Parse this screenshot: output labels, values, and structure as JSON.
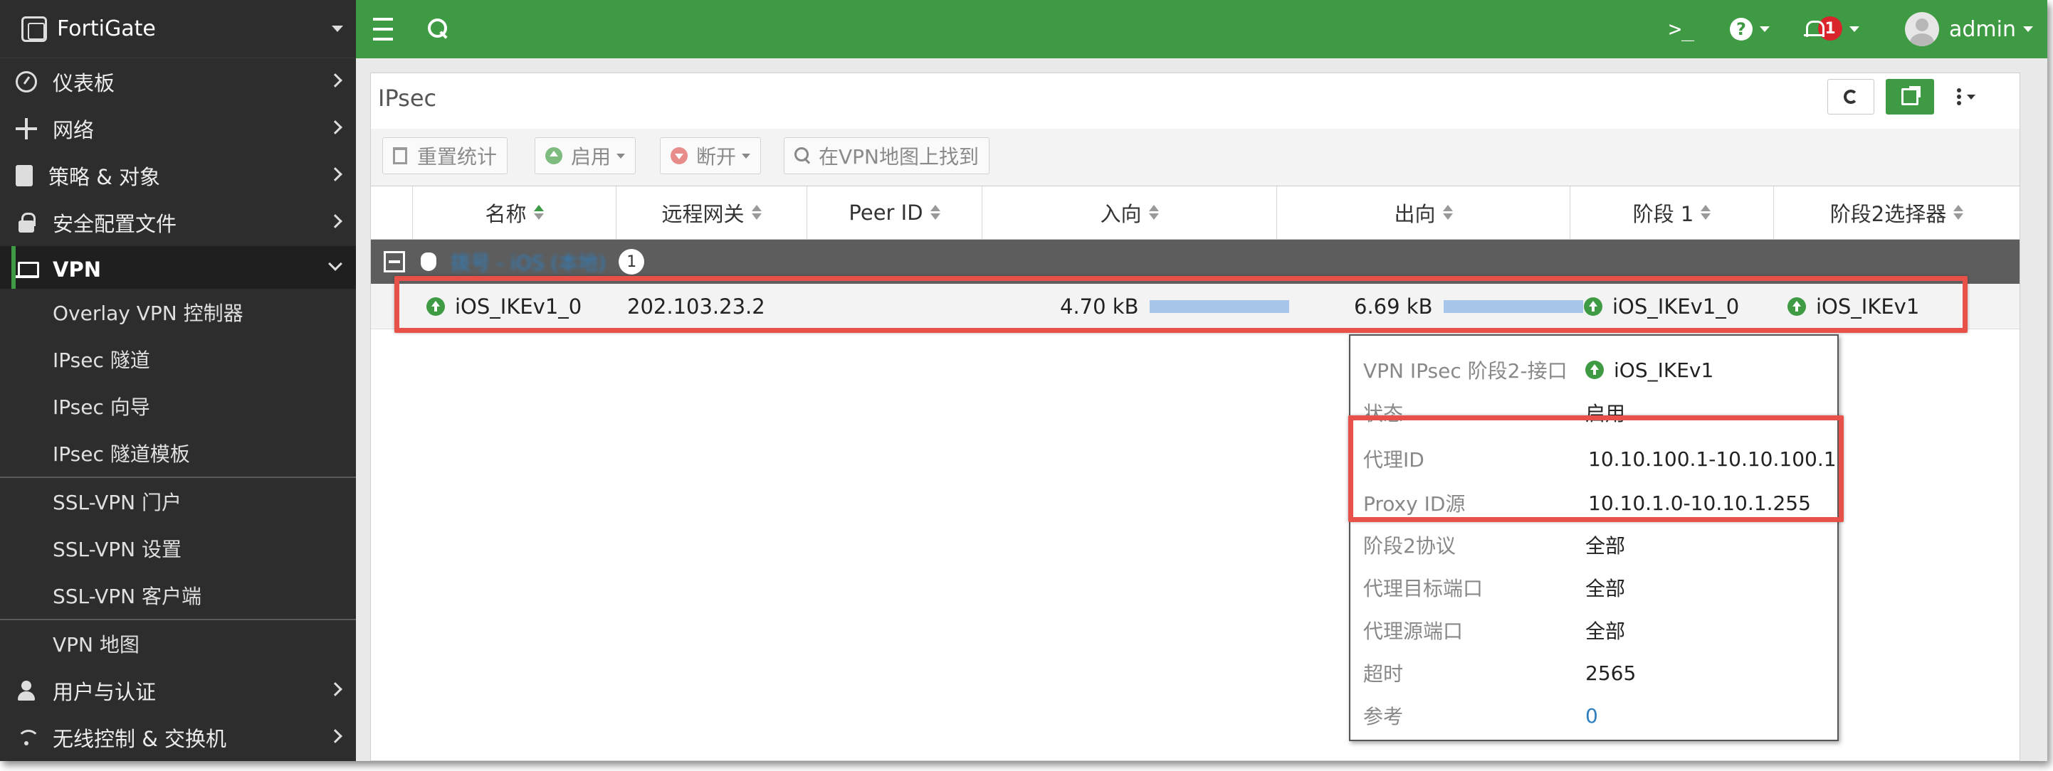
{
  "brand": {
    "name": "FortiGate"
  },
  "sidebar": {
    "items": [
      {
        "label": "仪表板",
        "icon": "dashboard-icon"
      },
      {
        "label": "网络",
        "icon": "move-icon"
      },
      {
        "label": "策略 & 对象",
        "icon": "policy-icon"
      },
      {
        "label": "安全配置文件",
        "icon": "lock-icon"
      },
      {
        "label": "VPN",
        "icon": "laptop-icon"
      },
      {
        "label": "用户与认证",
        "icon": "user-icon"
      },
      {
        "label": "无线控制 & 交换机",
        "icon": "wifi-icon"
      }
    ],
    "vpn_sub": [
      "Overlay VPN 控制器",
      "IPsec 隧道",
      "IPsec 向导",
      "IPsec 隧道模板",
      "SSL-VPN 门户",
      "SSL-VPN 设置",
      "SSL-VPN 客户端",
      "VPN 地图"
    ]
  },
  "topbar": {
    "cli_glyph": ">_",
    "help_glyph": "?",
    "notification_count": "1",
    "user": "admin"
  },
  "page": {
    "title": "IPsec",
    "toolbar": {
      "reset": "重置统计",
      "enable": "启用",
      "disconnect": "断开",
      "locate": "在VPN地图上找到"
    },
    "columns": [
      "名称",
      "远程网关",
      "Peer ID",
      "入向",
      "出向",
      "阶段 1",
      "阶段2选择器"
    ],
    "group": {
      "label": "拨号 - iOS (本地)",
      "count": "1"
    },
    "row": {
      "name": "iOS_IKEv1_0",
      "remote_gateway": "202.103.23.2",
      "peer_id": "",
      "incoming": "4.70 kB",
      "outgoing": "6.69 kB",
      "phase1": "iOS_IKEv1_0",
      "phase2": "iOS_IKEv1"
    }
  },
  "tooltip": {
    "rows": [
      {
        "key": "VPN IPsec 阶段2-接口",
        "value": "iOS_IKEv1"
      },
      {
        "key": "状态",
        "value": "启用"
      },
      {
        "key": "代理ID",
        "value": "10.10.100.1-10.10.100.1"
      },
      {
        "key": "Proxy ID源",
        "value": "10.10.1.0-10.10.1.255"
      },
      {
        "key": "阶段2协议",
        "value": "全部"
      },
      {
        "key": "代理目标端口",
        "value": "全部"
      },
      {
        "key": "代理源端口",
        "value": "全部"
      },
      {
        "key": "超时",
        "value": "2565"
      },
      {
        "key": "参考",
        "value": "0"
      }
    ]
  },
  "colors": {
    "accent": "#3f9b43",
    "sidebar": "#2d2d2d",
    "highlight": "#e8514a",
    "link": "#2f7fbf"
  }
}
